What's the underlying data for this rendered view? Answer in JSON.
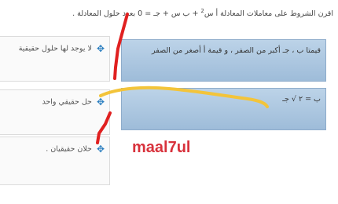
{
  "instruction": {
    "text_before_sup": "اقرن الشروط على معاملات المعادلة  أ س",
    "sup": "2",
    "text_after_sup": " + ب س + جـ = 0  بعدد حلول المعادلة ."
  },
  "answers": [
    {
      "label": "لا يوجد لها حلول حقيقية"
    },
    {
      "label": "حل حقيقي واحد"
    },
    {
      "label": "حلان حقيقيان ."
    }
  ],
  "drop_zones": [
    {
      "text": "قيمتا  ب ، جـ  أكبر من الصفر ، و قيمة  أ  أصغر من الصفر"
    },
    {
      "text": "ب  = ٢ √ جـ"
    }
  ],
  "watermark": "maal7ul",
  "colors": {
    "drop_zone": "#a9c4df",
    "drag_icon": "#2c7fc0",
    "watermark": "#d8323c",
    "annotation_red": "#e02020",
    "annotation_yellow": "#f3c43a"
  }
}
